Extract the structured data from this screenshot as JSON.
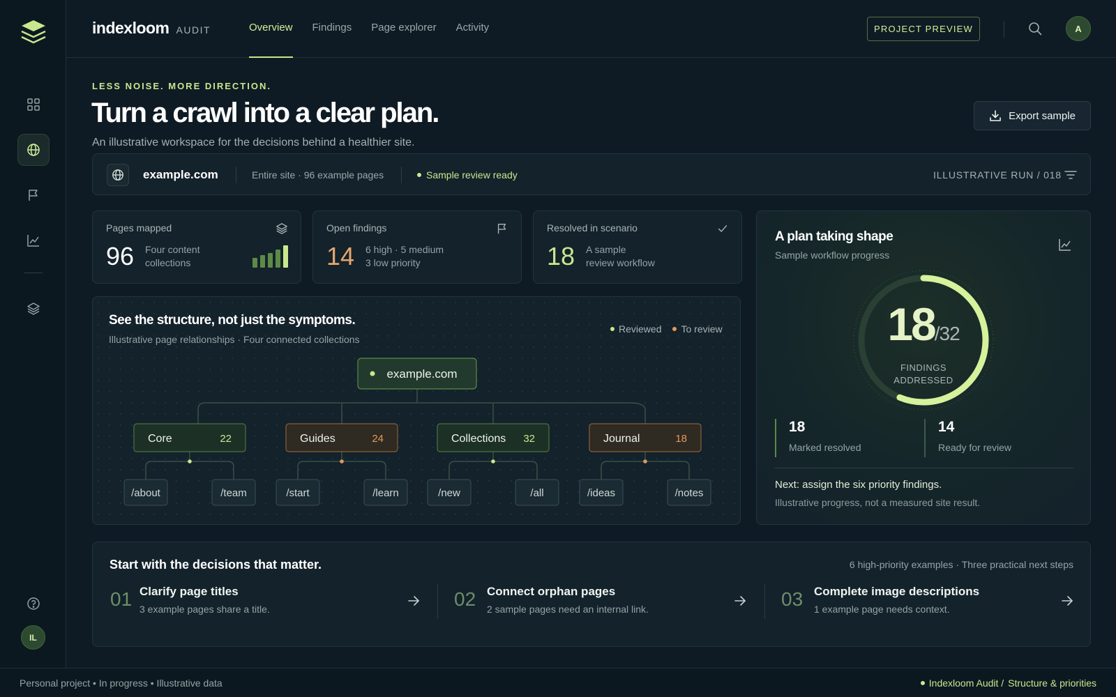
{
  "brand": {
    "name": "indexloom",
    "sub": "AUDIT"
  },
  "nav": [
    {
      "label": "Overview",
      "active": true
    },
    {
      "label": "Findings",
      "active": false
    },
    {
      "label": "Page explorer",
      "active": false
    },
    {
      "label": "Activity",
      "active": false
    }
  ],
  "topbar": {
    "preview_label": "PROJECT PREVIEW",
    "avatar": "A"
  },
  "sidebar": {
    "items": [
      {
        "icon": "grid-icon"
      },
      {
        "icon": "globe-icon",
        "active": true
      },
      {
        "icon": "flag-icon"
      },
      {
        "icon": "chart-icon"
      },
      {
        "icon": "layers-icon"
      }
    ],
    "help_icon": "help-icon",
    "avatar": "IL"
  },
  "hero": {
    "eyebrow": "LESS NOISE. MORE DIRECTION.",
    "headline": "Turn a crawl into a clear plan.",
    "subhead": "An illustrative workspace for the decisions behind a healthier site.",
    "export_label": "Export sample"
  },
  "site": {
    "domain": "example.com",
    "scope": "Entire site · 96 example pages",
    "status": "Sample review ready",
    "run": "ILLUSTRATIVE RUN / 018"
  },
  "metrics": [
    {
      "label": "Pages mapped",
      "value": "96",
      "desc1": "Four content",
      "desc2": "collections",
      "icon": "layers-icon",
      "bars": [
        0.45,
        0.55,
        0.65,
        0.8,
        1.0
      ]
    },
    {
      "label": "Open findings",
      "value": "14",
      "desc1": "6 high · 5 medium",
      "desc2": "3 low priority",
      "icon": "flag-icon"
    },
    {
      "label": "Resolved in scenario",
      "value": "18",
      "desc1": "A sample",
      "desc2": "review workflow",
      "icon": "check-icon"
    }
  ],
  "structure": {
    "title": "See the structure, not just the symptoms.",
    "subtitle": "Illustrative page relationships · Four connected collections",
    "legend": [
      {
        "label": "Reviewed",
        "color": "#c8e88e"
      },
      {
        "label": "To review",
        "color": "#e29a5c"
      }
    ],
    "root": "example.com",
    "collections": [
      {
        "name": "Core",
        "count": "22",
        "status": "reviewed",
        "pages": [
          "/about",
          "/team"
        ]
      },
      {
        "name": "Guides",
        "count": "24",
        "status": "to-review",
        "pages": [
          "/start",
          "/learn"
        ]
      },
      {
        "name": "Collections",
        "count": "32",
        "status": "reviewed",
        "pages": [
          "/new",
          "/all"
        ]
      },
      {
        "name": "Journal",
        "count": "18",
        "status": "to-review",
        "pages": [
          "/ideas",
          "/notes"
        ]
      }
    ]
  },
  "plan": {
    "title": "A plan taking shape",
    "subtitle": "Sample workflow progress",
    "addressed": "18",
    "total": "/32",
    "progress": 0.5625,
    "caption1": "FINDINGS",
    "caption2": "ADDRESSED",
    "stats": [
      {
        "value": "18",
        "label": "Marked resolved"
      },
      {
        "value": "14",
        "label": "Ready for review"
      }
    ],
    "next": "Next: assign the six priority findings.",
    "note": "Illustrative progress, not a measured site result."
  },
  "decisions": {
    "title": "Start with the decisions that matter.",
    "meta": "6 high-priority examples · Three practical next steps",
    "steps": [
      {
        "num": "01",
        "title": "Clarify page titles",
        "desc": "3 example pages share a title."
      },
      {
        "num": "02",
        "title": "Connect orphan pages",
        "desc": "2 sample pages need an internal link."
      },
      {
        "num": "03",
        "title": "Complete image descriptions",
        "desc": "1 example page needs context."
      }
    ]
  },
  "footer": {
    "left": "Personal project • In progress • Illustrative data",
    "right_app": "Indexloom Audit /",
    "right_section": "Structure & priorities"
  },
  "colors": {
    "accent": "#c8e88e",
    "warn": "#e29a5c",
    "bg": "#0f1b24",
    "card": "#13222b"
  }
}
